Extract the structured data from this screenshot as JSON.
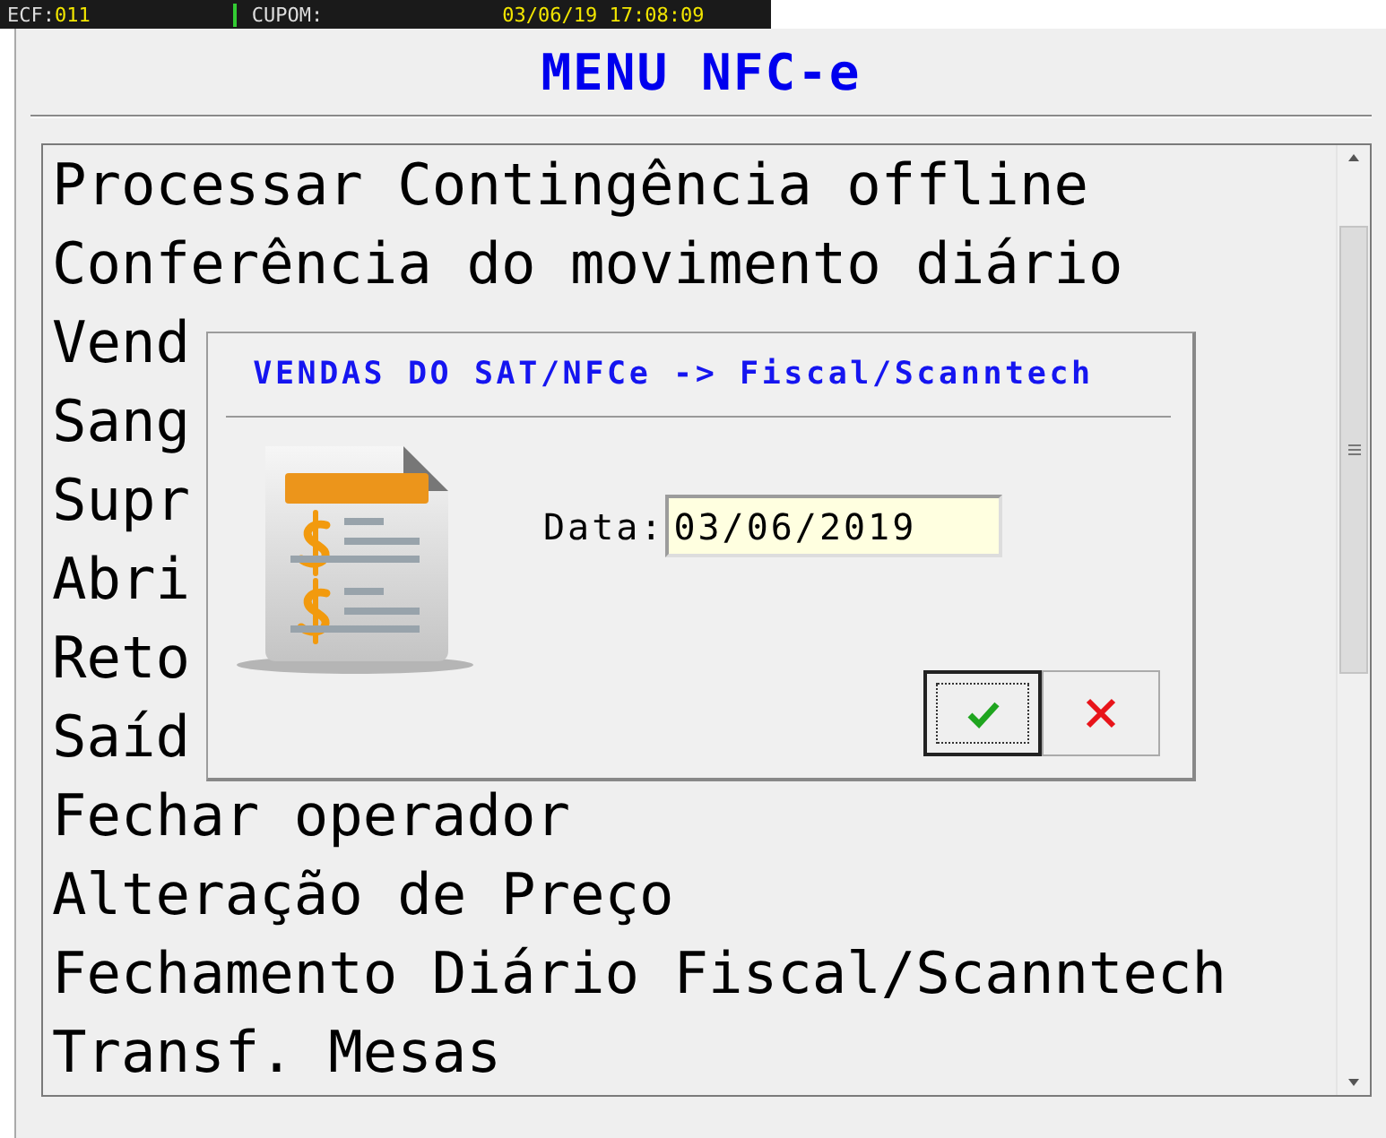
{
  "status_bar": {
    "ecf_label": "ECF:",
    "ecf": "011",
    "cupom_label": "CUPOM:",
    "datetime": "03/06/19 17:08:09"
  },
  "window": {
    "title": "MENU NFC-e"
  },
  "menu": {
    "items": [
      {
        "label": "Processar Contingência offline"
      },
      {
        "label": "Conferência do movimento diário"
      },
      {
        "label": "Vend"
      },
      {
        "label": "Sang"
      },
      {
        "label": "Supr"
      },
      {
        "label": "Abri"
      },
      {
        "label": "Reto"
      },
      {
        "label": "Saíd"
      },
      {
        "label": "Fechar operador"
      },
      {
        "label": "Alteração de Preço"
      },
      {
        "label": "Fechamento Diário Fiscal/Scanntech"
      },
      {
        "label": "Transf. Mesas"
      }
    ]
  },
  "dialog": {
    "title": "VENDAS DO SAT/NFCe -> Fiscal/Scanntech",
    "field": {
      "label": "Data:",
      "value": "03/06/2019"
    },
    "buttons": [
      {
        "kind": "ok",
        "focused": true
      },
      {
        "kind": "cancel",
        "focused": false
      }
    ]
  }
}
